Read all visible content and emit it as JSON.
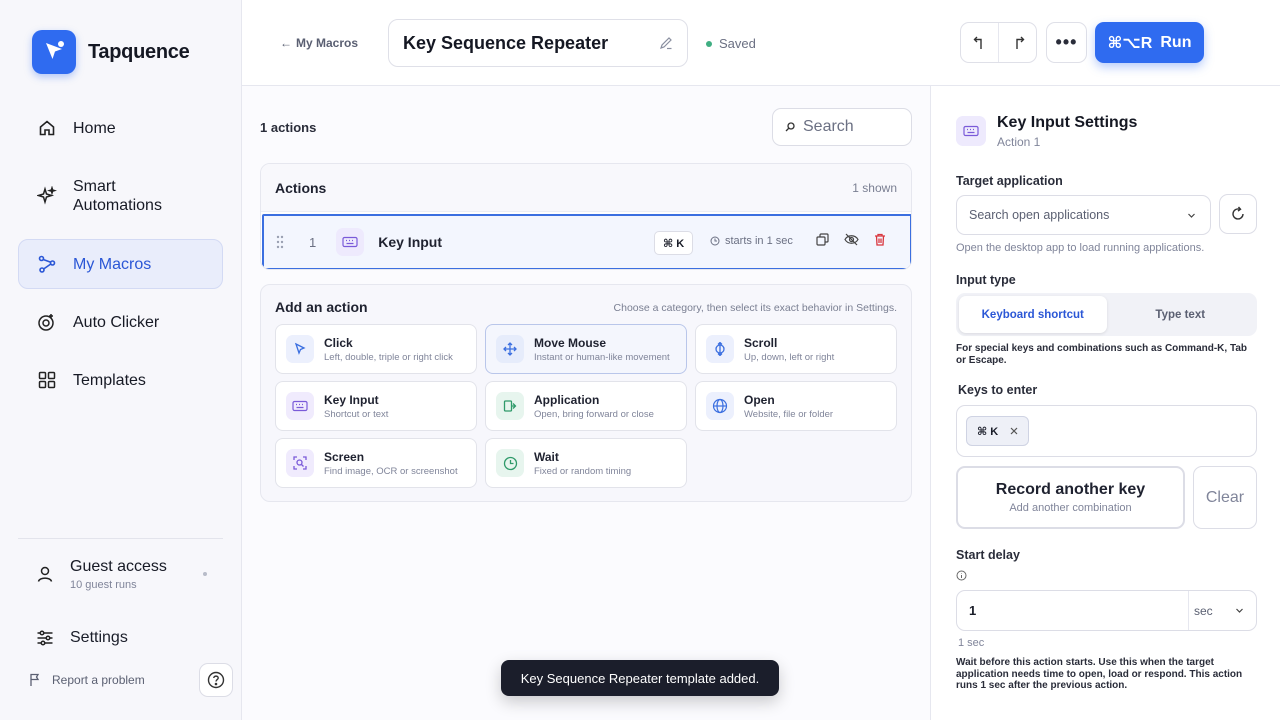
{
  "app": {
    "name": "Tapquence",
    "brand_color": "#2f6bf0"
  },
  "sidebar": {
    "items": [
      {
        "label": "Home",
        "icon": "home-icon"
      },
      {
        "label": "Smart Automations",
        "icon": "sparkle-icon"
      },
      {
        "label": "My Macros",
        "icon": "macro-icon",
        "active": true
      },
      {
        "label": "Auto Clicker",
        "icon": "target-icon"
      },
      {
        "label": "Templates",
        "icon": "grid-icon"
      }
    ],
    "guest": {
      "title": "Guest access",
      "sub": "10 guest runs"
    },
    "settings_label": "Settings",
    "report_label": "Report a problem"
  },
  "topbar": {
    "back_label": "My Macros",
    "macro_title": "Key Sequence Repeater",
    "saved_label": "Saved",
    "more_label": "•••",
    "run_shortcut": "⌘⌥R",
    "run_label": "Run"
  },
  "center": {
    "count_label": "1 actions",
    "search_placeholder": "Search",
    "actions_title": "Actions",
    "actions_shown": "1 shown",
    "row": {
      "index": "1",
      "name": "Key Input",
      "shortcut": "⌘ K",
      "starts": "starts in 1 sec"
    },
    "add": {
      "title": "Add an action",
      "hint": "Choose a category, then select its exact behavior in Settings.",
      "tiles": [
        {
          "title": "Click",
          "sub": "Left, double, triple or right click",
          "icon": "cursor-icon"
        },
        {
          "title": "Move Mouse",
          "sub": "Instant or human-like movement",
          "icon": "move-icon"
        },
        {
          "title": "Scroll",
          "sub": "Up, down, left or right",
          "icon": "scroll-icon"
        },
        {
          "title": "Key Input",
          "sub": "Shortcut or text",
          "icon": "keyboard-icon"
        },
        {
          "title": "Application",
          "sub": "Open, bring forward or close",
          "icon": "app-icon"
        },
        {
          "title": "Open",
          "sub": "Website, file or folder",
          "icon": "globe-icon"
        },
        {
          "title": "Screen",
          "sub": "Find image, OCR or screenshot",
          "icon": "screen-icon"
        },
        {
          "title": "Wait",
          "sub": "Fixed or random timing",
          "icon": "clock-icon"
        }
      ]
    },
    "toast": "Key Sequence Repeater template added."
  },
  "panel": {
    "title": "Key Input Settings",
    "sub": "Action 1",
    "target_label": "Target application",
    "app_placeholder": "Search open applications",
    "app_note": "Open the desktop app to load running applications.",
    "input_type_label": "Input type",
    "seg_shortcut": "Keyboard shortcut",
    "seg_text": "Type text",
    "seg_note": "For special keys and combinations such as Command-K, Tab or Escape.",
    "keys_label": "Keys to enter",
    "chip": "⌘ K",
    "record_title": "Record another key",
    "record_sub": "Add another combination",
    "clear_label": "Clear",
    "delay_label": "Start delay",
    "delay_value": "1",
    "delay_unit": "sec",
    "delay_readout": "1 sec",
    "delay_note": "Wait before this action starts. Use this when the target application needs time to open, load or respond. This action runs 1 sec after the previous action."
  }
}
